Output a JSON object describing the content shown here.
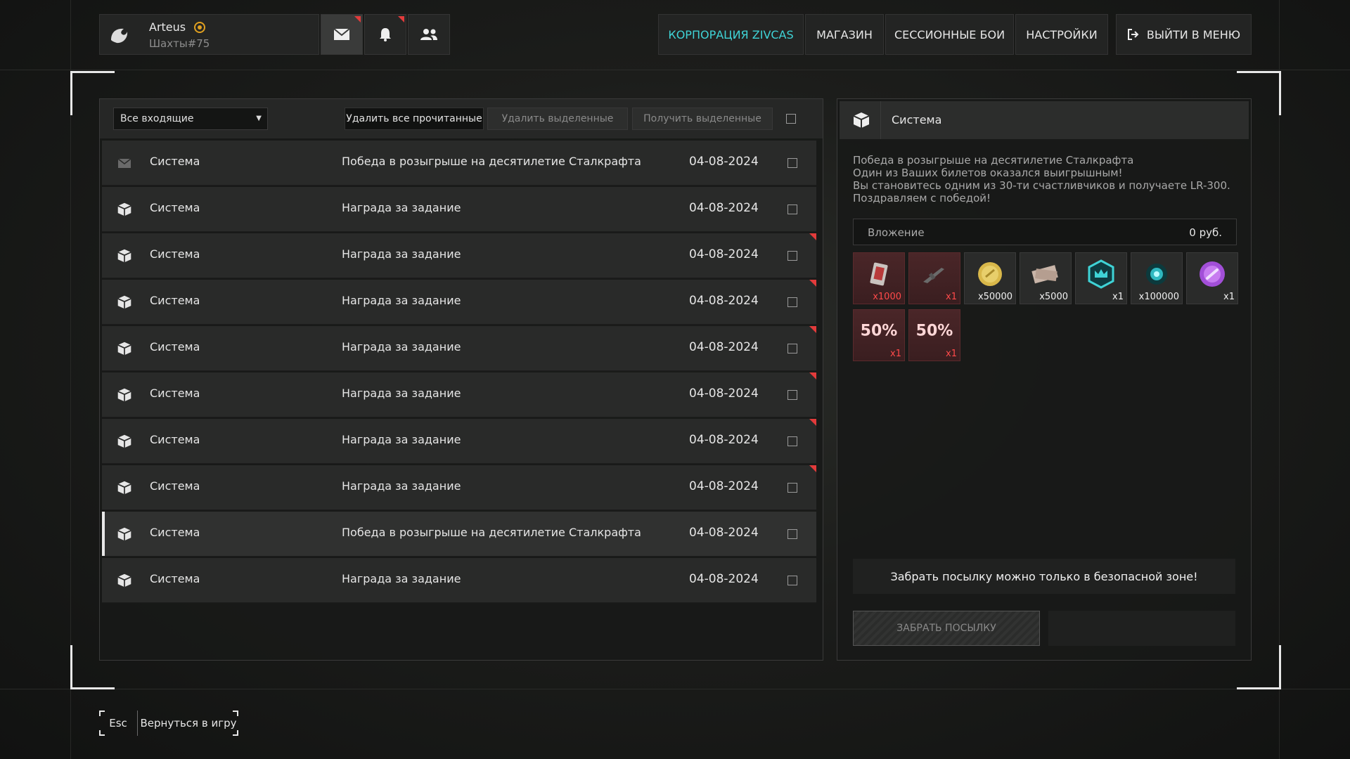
{
  "profile": {
    "name": "Arteus",
    "location": "Шахты#75"
  },
  "top_icons": {
    "mail": "mail-icon",
    "bell": "bell-icon",
    "friends": "friends-icon"
  },
  "nav": {
    "corporation": "КОРПОРАЦИЯ ZIVCAS",
    "shop": "МАГАЗИН",
    "sessions": "СЕССИОННЫЕ БОИ",
    "settings": "НАСТРОЙКИ",
    "exit": "ВЫЙТИ В МЕНЮ"
  },
  "colors": {
    "accent": "#3fd3d6",
    "unread": "#e23b3b"
  },
  "toolbar": {
    "filter": "Все входящие",
    "delete_read": "Удалить все прочитанные",
    "delete_selected": "Удалить выделенные",
    "receive_selected": "Получить выделенные"
  },
  "messages": [
    {
      "sender": "Система",
      "subject": "Победа в розыгрыше на десятилетие Сталкрафта",
      "date": "04-08-2024",
      "icon": "envelope-icon",
      "unread": false
    },
    {
      "sender": "Система",
      "subject": "Награда за задание",
      "date": "04-08-2024",
      "icon": "package-icon",
      "unread": false
    },
    {
      "sender": "Система",
      "subject": "Награда за задание",
      "date": "04-08-2024",
      "icon": "package-icon",
      "unread": true
    },
    {
      "sender": "Система",
      "subject": "Награда за задание",
      "date": "04-08-2024",
      "icon": "package-icon",
      "unread": true
    },
    {
      "sender": "Система",
      "subject": "Награда за задание",
      "date": "04-08-2024",
      "icon": "package-icon",
      "unread": true
    },
    {
      "sender": "Система",
      "subject": "Награда за задание",
      "date": "04-08-2024",
      "icon": "package-icon",
      "unread": true
    },
    {
      "sender": "Система",
      "subject": "Награда за задание",
      "date": "04-08-2024",
      "icon": "package-icon",
      "unread": true
    },
    {
      "sender": "Система",
      "subject": "Награда за задание",
      "date": "04-08-2024",
      "icon": "package-icon",
      "unread": true
    },
    {
      "sender": "Система",
      "subject": "Победа в розыгрыше на десятилетие Сталкрафта",
      "date": "04-08-2024",
      "icon": "package-icon",
      "unread": false,
      "selected": true
    },
    {
      "sender": "Система",
      "subject": "Награда за задание",
      "date": "04-08-2024",
      "icon": "package-icon",
      "unread": false
    }
  ],
  "detail": {
    "sender": "Система",
    "lines": [
      "Победа в розыгрыше на десятилетие Сталкрафта",
      "Один из Ваших билетов оказался выигрышным!",
      "Вы становитесь одним из 30-ти счастливчиков и получаете LR-300.",
      "Поздравляем с победой!"
    ],
    "attachment_label": "Вложение",
    "attachment_amount": "0 руб.",
    "items": [
      {
        "icon": "ticket-icon",
        "qty": "x1000",
        "red": true
      },
      {
        "icon": "rifle-icon",
        "qty": "x1",
        "red": true
      },
      {
        "icon": "coin-icon",
        "qty": "x50000",
        "red": false
      },
      {
        "icon": "money-icon",
        "qty": "x5000",
        "red": false
      },
      {
        "icon": "crown-badge-icon",
        "qty": "x1",
        "red": false
      },
      {
        "icon": "energy-orb-icon",
        "qty": "x100000",
        "red": false
      },
      {
        "icon": "purple-link-icon",
        "qty": "x1",
        "red": false
      },
      {
        "icon": "discount-icon",
        "qty": "x1",
        "label": "50%",
        "red": true
      },
      {
        "icon": "discount-icon",
        "qty": "x1",
        "label": "50%",
        "red": true
      }
    ],
    "notice": "Забрать посылку можно только в безопасной зоне!",
    "claim": "ЗАБРАТЬ ПОСЫЛКУ"
  },
  "footer": {
    "key": "Esc",
    "back": "Вернуться в игру"
  }
}
